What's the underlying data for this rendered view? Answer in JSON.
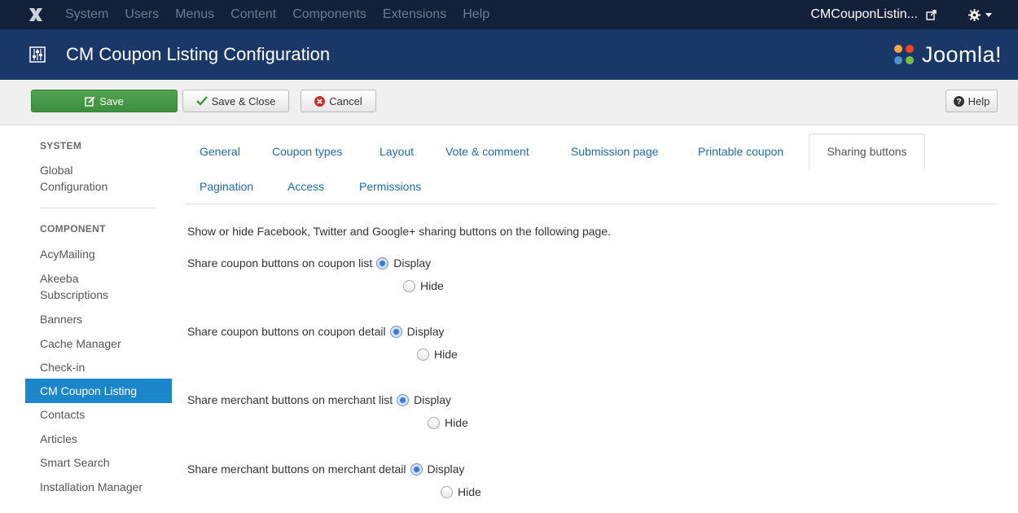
{
  "topbar": {
    "menu": [
      "System",
      "Users",
      "Menus",
      "Content",
      "Components",
      "Extensions",
      "Help"
    ],
    "site_name": "CMCouponListin...",
    "logo_icon": "joomla-x-icon",
    "ext_icon": "external-link-icon",
    "settings_icon": "gear-icon"
  },
  "titlebar": {
    "title": "CM Coupon Listing Configuration",
    "brand": "Joomla!",
    "title_icon": "sliders-icon"
  },
  "toolbar": {
    "save_label": "Save",
    "save_close_label": "Save & Close",
    "cancel_label": "Cancel",
    "help_label": "Help"
  },
  "sidebar": {
    "system_heading": "SYSTEM",
    "system_items": [
      {
        "label": "Global\nConfiguration"
      }
    ],
    "component_heading": "COMPONENT",
    "items": [
      {
        "label": "AcyMailing"
      },
      {
        "label": "Akeeba Subscriptions"
      },
      {
        "label": "Banners"
      },
      {
        "label": "Cache Manager"
      },
      {
        "label": "Check-in"
      },
      {
        "label": "CM Coupon Listing"
      },
      {
        "label": "Contacts"
      },
      {
        "label": "Articles"
      },
      {
        "label": "Smart Search"
      },
      {
        "label": "Installation Manager"
      }
    ]
  },
  "tabs": [
    {
      "label": "General"
    },
    {
      "label": "Coupon types"
    },
    {
      "label": "Layout"
    },
    {
      "label": "Vote & comment"
    },
    {
      "label": "Submission page"
    },
    {
      "label": "Printable coupon"
    },
    {
      "label": "Sharing buttons"
    },
    {
      "label": "Pagination"
    },
    {
      "label": "Access"
    },
    {
      "label": "Permissions"
    }
  ],
  "form": {
    "description": "Show or hide Facebook, Twitter and Google+ sharing buttons on the following page.",
    "rows": [
      {
        "label": "Share coupon buttons on coupon list",
        "option_display": "Display",
        "option_hide": "Hide",
        "selected": "Display"
      },
      {
        "label": "Share coupon buttons on coupon detail",
        "option_display": "Display",
        "option_hide": "Hide",
        "selected": "Display"
      },
      {
        "label": "Share merchant buttons on merchant list",
        "option_display": "Display",
        "option_hide": "Hide",
        "selected": "Display"
      },
      {
        "label": "Share merchant buttons on merchant detail",
        "option_display": "Display",
        "option_hide": "Hide",
        "selected": "Display"
      }
    ]
  }
}
